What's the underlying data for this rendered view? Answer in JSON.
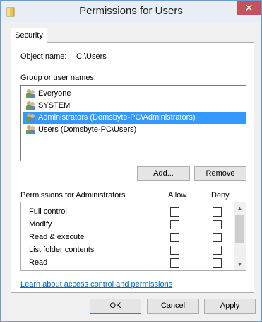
{
  "window": {
    "title": "Permissions for Users",
    "close_glyph": "✕"
  },
  "tabs": [
    {
      "label": "Security"
    }
  ],
  "object": {
    "label": "Object name:",
    "value": "C:\\Users"
  },
  "groups": {
    "label": "Group or user names:",
    "items": [
      {
        "label": "Everyone"
      },
      {
        "label": "SYSTEM"
      },
      {
        "label": "Administrators (Domsbyte-PC\\Administrators)",
        "selected": true
      },
      {
        "label": "Users (Domsbyte-PC\\Users)"
      }
    ],
    "add_label": "Add...",
    "remove_label": "Remove"
  },
  "permissions": {
    "label": "Permissions for Administrators",
    "allow_label": "Allow",
    "deny_label": "Deny",
    "rows": [
      {
        "name": "Full control"
      },
      {
        "name": "Modify"
      },
      {
        "name": "Read & execute"
      },
      {
        "name": "List folder contents"
      },
      {
        "name": "Read"
      }
    ]
  },
  "link": {
    "label": "Learn about access control and permissions"
  },
  "footer": {
    "ok_label": "OK",
    "cancel_label": "Cancel",
    "apply_label": "Apply"
  },
  "colors": {
    "accent": "#3399ff",
    "close": "#c7505c",
    "link": "#0066cc"
  }
}
